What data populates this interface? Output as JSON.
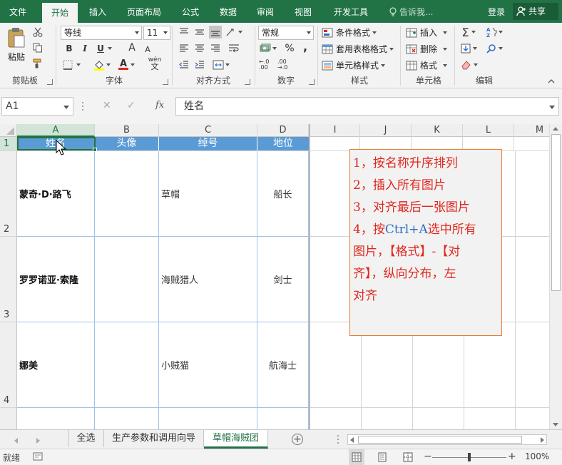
{
  "ribbon_tabs": [
    "文件",
    "开始",
    "插入",
    "页面布局",
    "公式",
    "数据",
    "审阅",
    "视图",
    "开发工具"
  ],
  "active_tab": "开始",
  "tell_me": "告诉我...",
  "login": "登录",
  "share": "共享",
  "clipboard": {
    "paste": "粘贴",
    "label": "剪贴板"
  },
  "font": {
    "name": "等线",
    "size": "11",
    "label": "字体",
    "bold": "B",
    "italic": "I",
    "underline": "U",
    "grow": "A",
    "shrink": "A",
    "phonetic": "wén"
  },
  "alignment": {
    "label": "对齐方式"
  },
  "number": {
    "format": "常规",
    "label": "数字",
    "percent": "%",
    "comma": ",",
    "inc_dec": "←.0 .00",
    "dec_dec": ".00 →.0"
  },
  "styles": {
    "conditional": "条件格式",
    "table": "套用表格格式",
    "cell": "单元格样式",
    "label": "样式"
  },
  "cells": {
    "insert": "插入",
    "delete": "删除",
    "format": "格式",
    "label": "单元格"
  },
  "editing": {
    "label": "编辑"
  },
  "formula_bar": {
    "name_box": "A1",
    "formula": "姓名",
    "cancel": "✕",
    "enter": "✓",
    "fx": "fx"
  },
  "columns": [
    "A",
    "B",
    "C",
    "D",
    "I",
    "J",
    "K",
    "L",
    "M"
  ],
  "rows": [
    "1",
    "2",
    "3",
    "4"
  ],
  "table": {
    "headers": [
      "姓名",
      "头像",
      "绰号",
      "地位"
    ],
    "rows": [
      {
        "name": "蒙奇·D·路飞",
        "avatar": "",
        "nickname": "草帽",
        "role": "船长"
      },
      {
        "name": "罗罗诺亚·索隆",
        "avatar": "",
        "nickname": "海贼猎人",
        "role": "剑士"
      },
      {
        "name": "娜美",
        "avatar": "",
        "nickname": "小贼猫",
        "role": "航海士"
      }
    ]
  },
  "note": {
    "line1": "1，按名称升序排列",
    "line2": "2，插入所有图片",
    "line3": "3，对齐最后一张图片",
    "line4a": "4，按",
    "line4b": "Ctrl+A",
    "line4c": "选中所有",
    "line5": "图片，【格式】-【对",
    "line6": "齐】，纵向分布，左",
    "line7": "对齐"
  },
  "sheet_tabs": [
    "全选",
    "生产参数和调用向导",
    "草帽海贼团"
  ],
  "active_sheet": "草帽海贼团",
  "status": {
    "mode": "就绪",
    "zoom": "100%",
    "minus": "−",
    "plus": "+"
  },
  "colors": {
    "brand": "#217346",
    "table_header": "#5b9bd5",
    "table_border": "#9dc3e6",
    "note_border": "#ed7d31",
    "note_text": "#e0271e",
    "note_blue": "#2b6cc4"
  }
}
